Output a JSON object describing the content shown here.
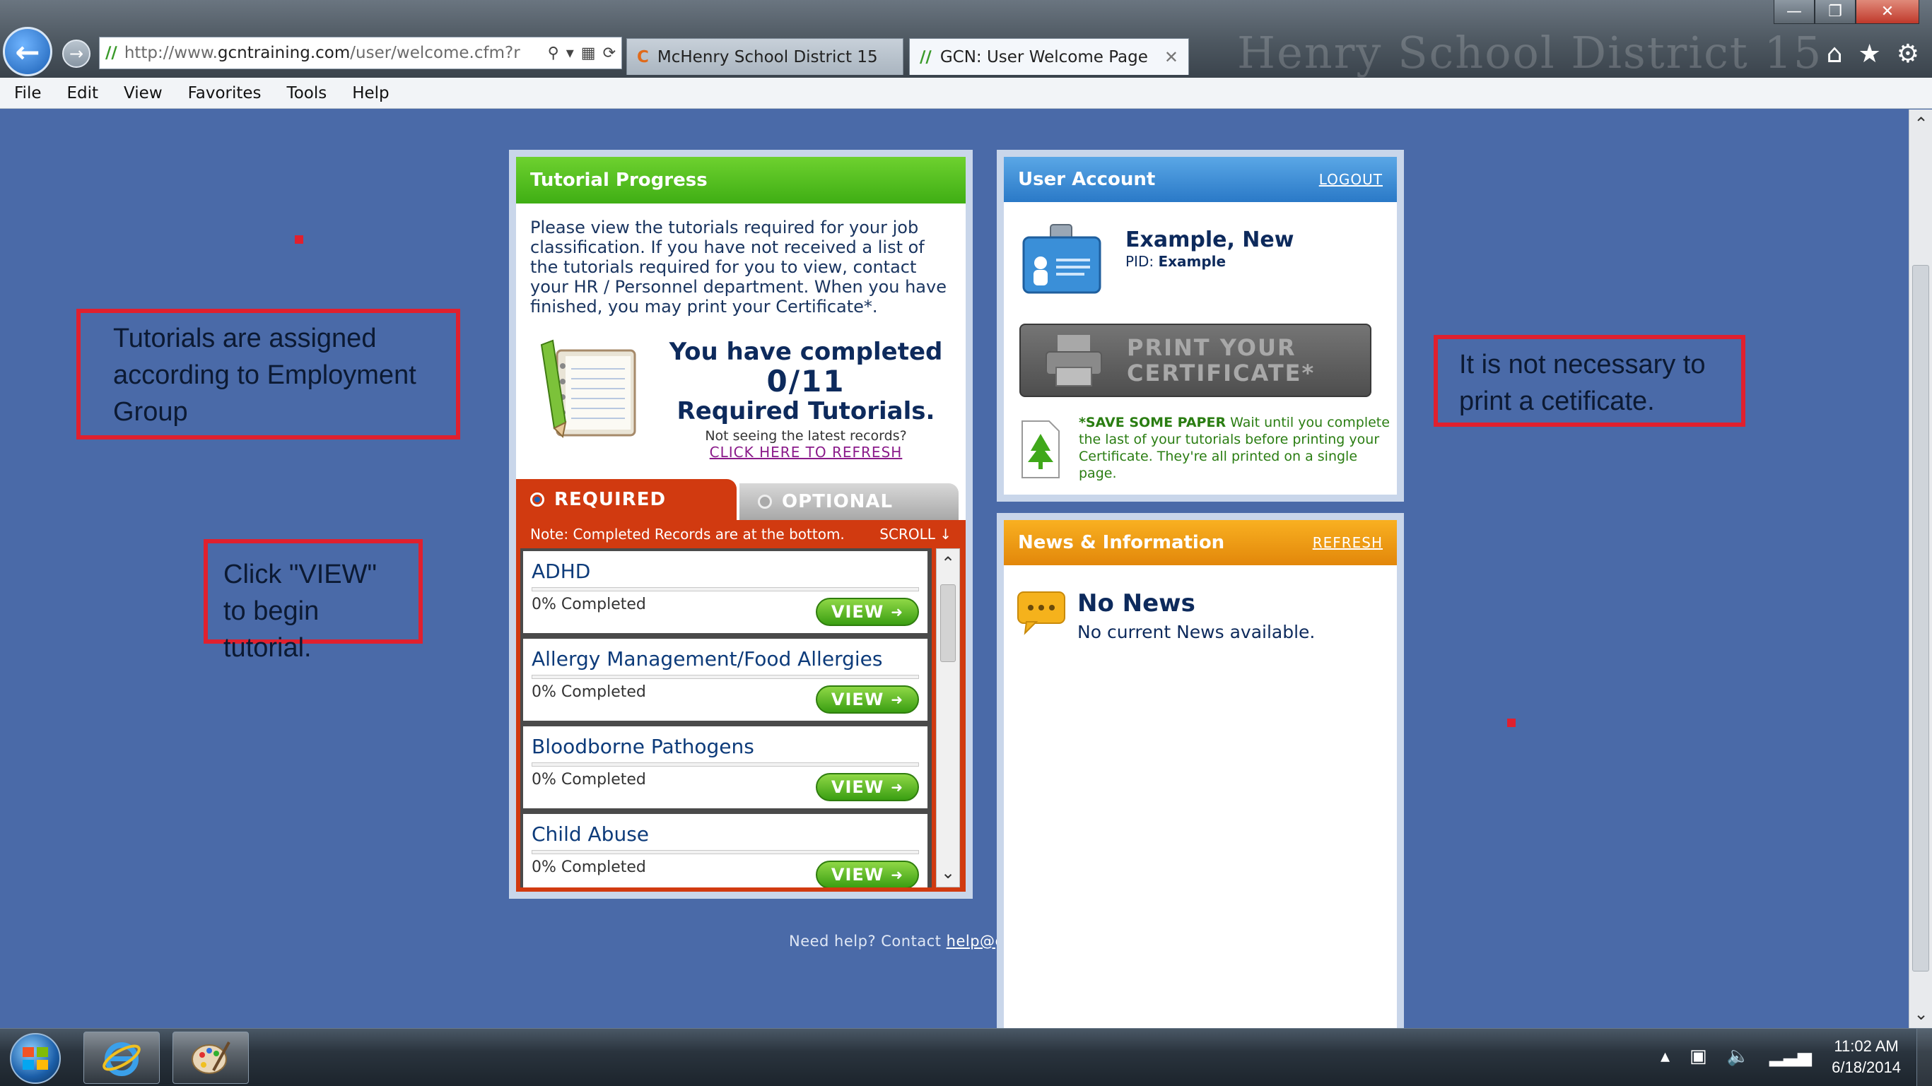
{
  "browser": {
    "address_url_plain": "http://www.",
    "address_url_domain": "gcntraining.com",
    "address_url_path": "/user/welcome.cfm?r",
    "tabs": [
      {
        "label": "McHenry School District 15",
        "active": false
      },
      {
        "label": "GCN: User Welcome Page",
        "active": true
      }
    ],
    "watermark": "Henry School District 15",
    "window_buttons": {
      "minimize": "—",
      "restore": "❐",
      "close": "✕"
    },
    "menu": [
      "File",
      "Edit",
      "View",
      "Favorites",
      "Tools",
      "Help"
    ]
  },
  "annotations": {
    "assigned": "Tutorials are assigned according to Employment Group",
    "click_view": "Click \"VIEW\" to begin tutorial.",
    "certificate": "It is not necessary to print a cetificate."
  },
  "tutorial_progress": {
    "header": "Tutorial Progress",
    "intro": "Please view the tutorials required for your job classification. If you have not received a list of the tutorials required for you to view, contact your HR / Personnel department. When you have finished, you may print your Certificate*.",
    "completed_line1": "You have completed",
    "completed_count": "0/11",
    "completed_line3": "Required Tutorials.",
    "refresh_prompt": "Not seeing the latest records?",
    "refresh_link": "CLICK HERE TO REFRESH",
    "tab_required": "REQUIRED",
    "tab_optional": "OPTIONAL",
    "note": "Note: Completed Records are at the bottom.",
    "scroll_label": "SCROLL ↓",
    "view_label": "VIEW",
    "items": [
      {
        "title": "ADHD",
        "progress": "0% Completed",
        "progress_pct": 0
      },
      {
        "title": "Allergy Management/Food Allergies",
        "progress": "0% Completed",
        "progress_pct": 0
      },
      {
        "title": "Bloodborne Pathogens",
        "progress": "0% Completed",
        "progress_pct": 0
      },
      {
        "title": "Child Abuse",
        "progress": "0% Completed",
        "progress_pct": 0
      }
    ]
  },
  "help": {
    "text": "Need help? Contact ",
    "link": "help@g"
  },
  "user_account": {
    "header": "User Account",
    "logout": "LOGOUT",
    "name": "Example, New",
    "pid_label": "PID:",
    "pid_value": "Example",
    "print_line1": "PRINT YOUR",
    "print_line2": "CERTIFICATE*",
    "save_paper_bold": "*SAVE SOME PAPER",
    "save_paper_text": " Wait until you complete the last of your tutorials before printing your Certificate. They're all printed on a single page."
  },
  "news": {
    "header": "News & Information",
    "refresh": "REFRESH",
    "title": "No News",
    "subtitle": "No current News available."
  },
  "taskbar": {
    "time": "11:02 AM",
    "date": "6/18/2014"
  }
}
